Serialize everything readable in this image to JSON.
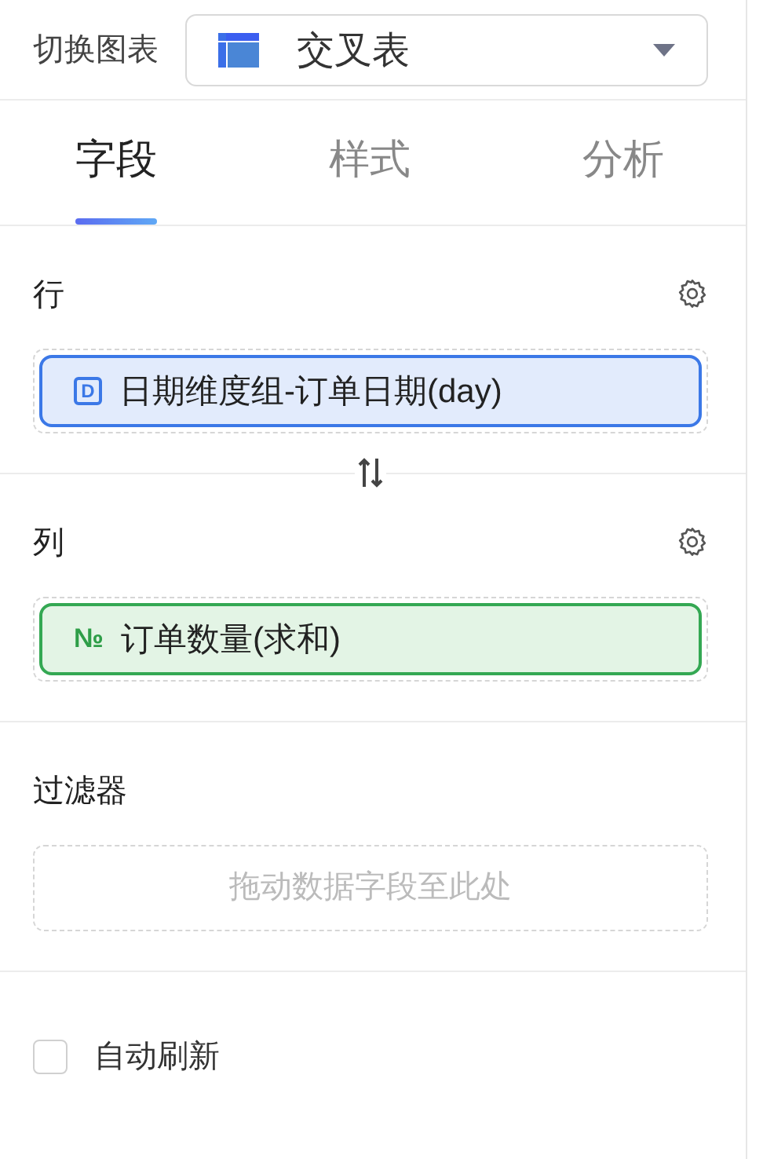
{
  "chart_switch": {
    "label": "切换图表",
    "value": "交叉表"
  },
  "tabs": [
    {
      "label": "字段",
      "selected": true
    },
    {
      "label": "样式",
      "selected": false
    },
    {
      "label": "分析",
      "selected": false
    }
  ],
  "sections": [
    {
      "title": "行",
      "settings": true,
      "fields": [
        {
          "kind": "date",
          "icon": "D",
          "label": "日期维度组-订单日期(day)"
        }
      ]
    },
    {
      "title": "列",
      "settings": true,
      "fields": [
        {
          "kind": "number",
          "icon": "№",
          "label": "订单数量(求和)"
        }
      ]
    },
    {
      "title": "过滤器",
      "settings": false,
      "placeholder": "拖动数据字段至此处"
    }
  ],
  "auto_refresh": {
    "label": "自动刷新",
    "checked": false
  }
}
